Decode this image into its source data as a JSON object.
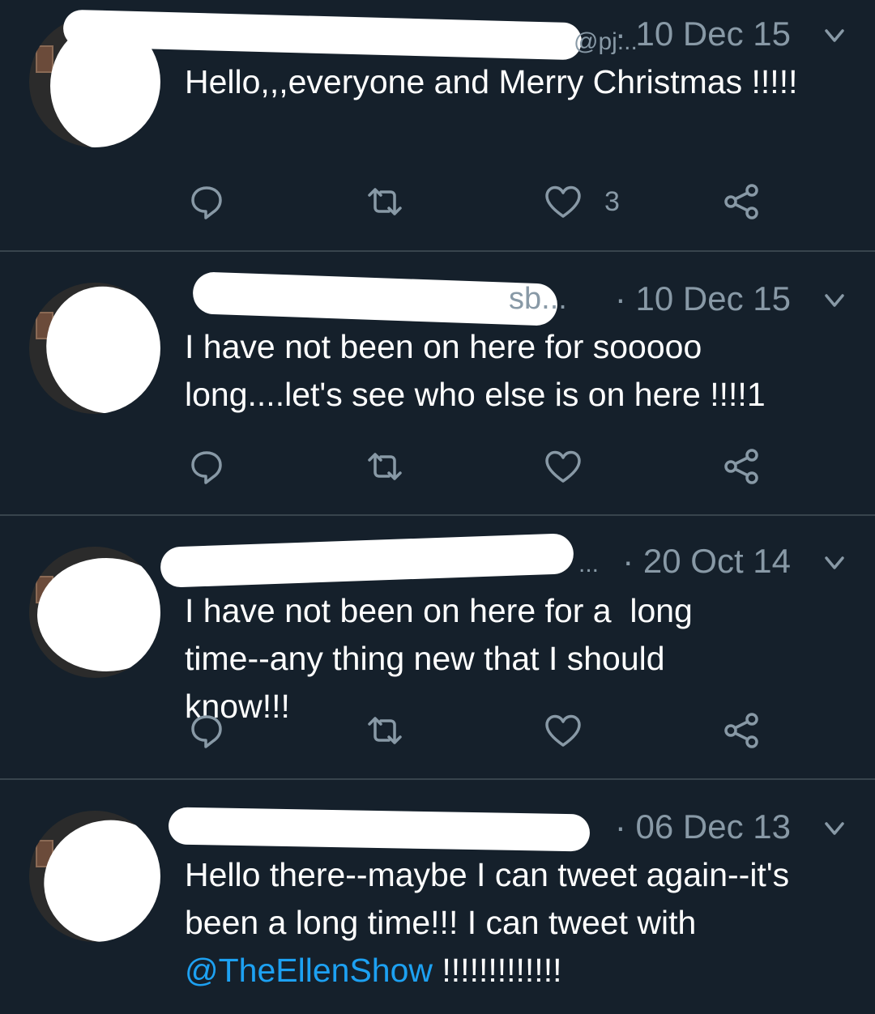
{
  "tweets": [
    {
      "handle_tail": "@pj...",
      "date": "· 10 Dec 15",
      "text": "Hello,,,everyone and Merry Christmas !!!!!",
      "mention": "",
      "text_after_mention": "",
      "like_count": "3"
    },
    {
      "handle_tail": "sb...",
      "date": "· 10 Dec 15",
      "text": "I have not been on here for sooooo long....let's see who else is on here !!!!1",
      "mention": "",
      "text_after_mention": "",
      "like_count": ""
    },
    {
      "handle_tail": "...",
      "date": "· 20 Oct 14",
      "text": "I have not been on here for a  long time--any thing new that I should know!!!",
      "mention": "",
      "text_after_mention": "",
      "like_count": ""
    },
    {
      "handle_tail": "",
      "date": "· 06 Dec 13",
      "text": "Hello there--maybe I can tweet again--it's been a long time!!! I can tweet with ",
      "mention": "@TheEllenShow",
      "text_after_mention": " !!!!!!!!!!!!!",
      "like_count": ""
    }
  ],
  "icons": {
    "reply": "reply-icon",
    "retweet": "retweet-icon",
    "like": "heart-icon",
    "share": "share-icon",
    "caret": "chevron-down-icon"
  },
  "colors": {
    "background": "#15202b",
    "divider": "#38444d",
    "secondary_text": "#8899a6",
    "link": "#1da1f2"
  }
}
